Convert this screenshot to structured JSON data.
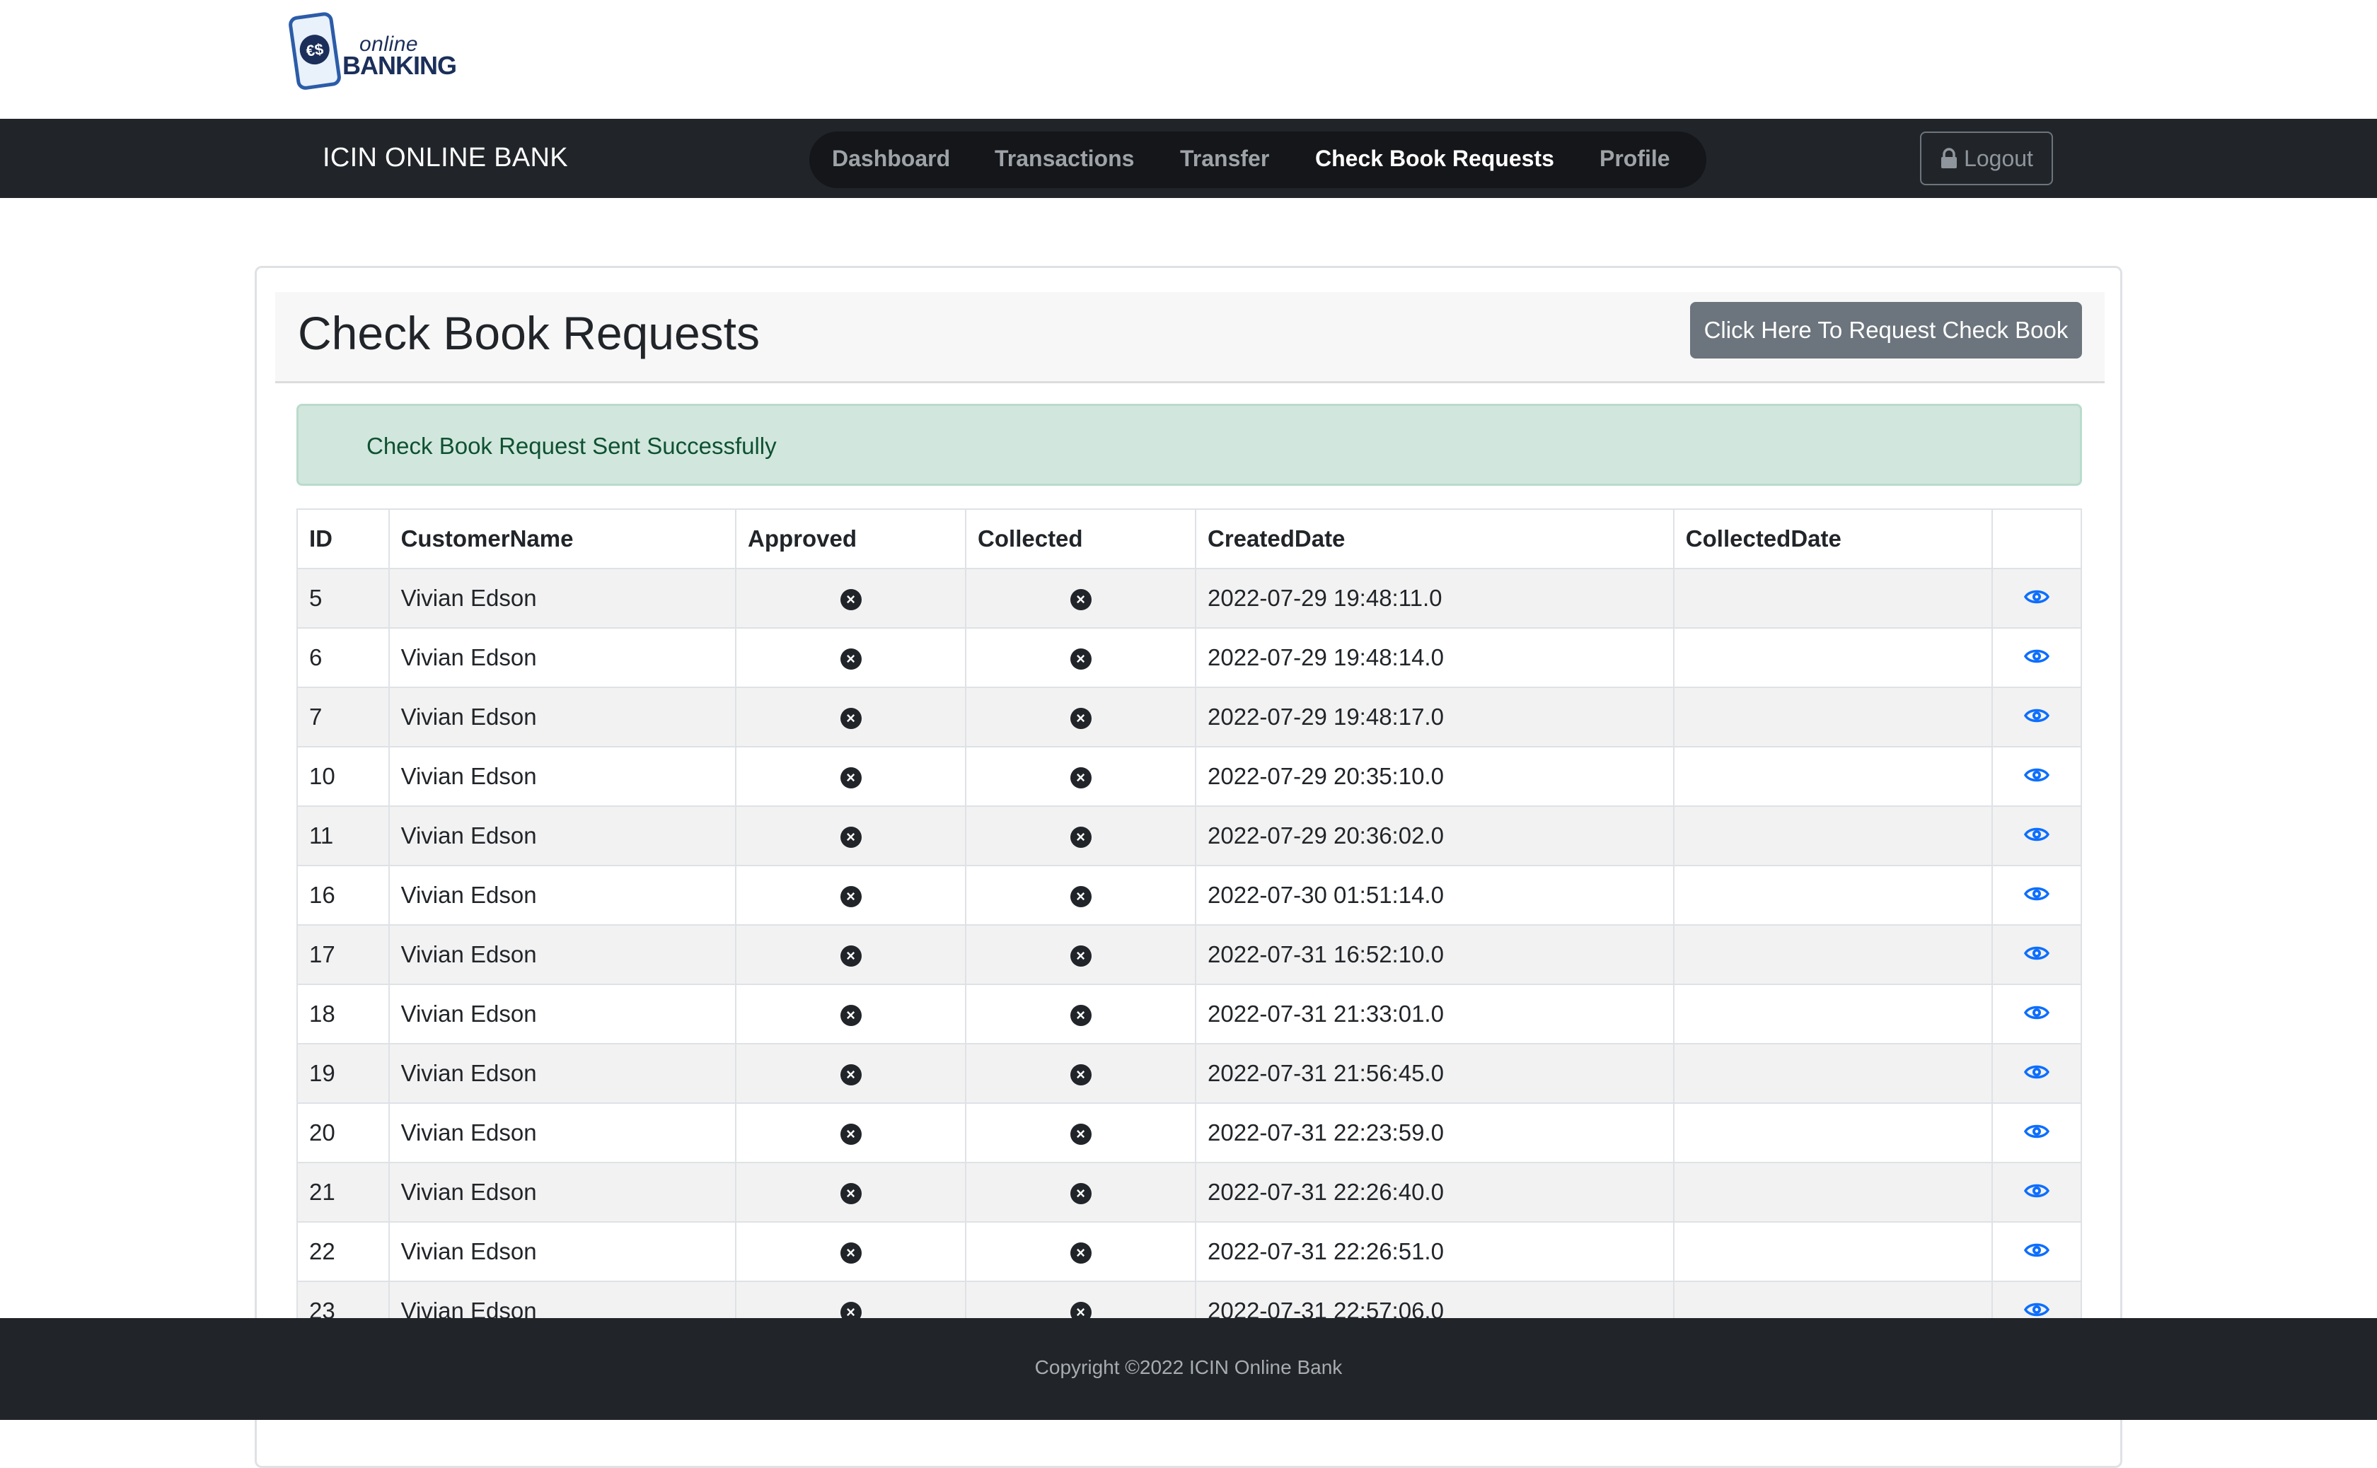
{
  "logo": {
    "small": "online",
    "big": "BANKING"
  },
  "navbar": {
    "brand": "ICIN ONLINE BANK",
    "links": [
      "Dashboard",
      "Transactions",
      "Transfer",
      "Check Book Requests",
      "Profile"
    ],
    "active": "Check Book Requests",
    "logout_label": "Logout"
  },
  "page": {
    "title": "Check Book Requests",
    "request_button": "Click Here To Request Check Book",
    "alert": "Check Book Request Sent Successfully"
  },
  "table": {
    "headers": [
      "ID",
      "CustomerName",
      "Approved",
      "Collected",
      "CreatedDate",
      "CollectedDate",
      ""
    ],
    "rows": [
      {
        "id": "5",
        "name": "Vivian Edson",
        "approved": false,
        "collected": false,
        "created": "2022-07-29 19:48:11.0",
        "collected_date": ""
      },
      {
        "id": "6",
        "name": "Vivian Edson",
        "approved": false,
        "collected": false,
        "created": "2022-07-29 19:48:14.0",
        "collected_date": ""
      },
      {
        "id": "7",
        "name": "Vivian Edson",
        "approved": false,
        "collected": false,
        "created": "2022-07-29 19:48:17.0",
        "collected_date": ""
      },
      {
        "id": "10",
        "name": "Vivian Edson",
        "approved": false,
        "collected": false,
        "created": "2022-07-29 20:35:10.0",
        "collected_date": ""
      },
      {
        "id": "11",
        "name": "Vivian Edson",
        "approved": false,
        "collected": false,
        "created": "2022-07-29 20:36:02.0",
        "collected_date": ""
      },
      {
        "id": "16",
        "name": "Vivian Edson",
        "approved": false,
        "collected": false,
        "created": "2022-07-30 01:51:14.0",
        "collected_date": ""
      },
      {
        "id": "17",
        "name": "Vivian Edson",
        "approved": false,
        "collected": false,
        "created": "2022-07-31 16:52:10.0",
        "collected_date": ""
      },
      {
        "id": "18",
        "name": "Vivian Edson",
        "approved": false,
        "collected": false,
        "created": "2022-07-31 21:33:01.0",
        "collected_date": ""
      },
      {
        "id": "19",
        "name": "Vivian Edson",
        "approved": false,
        "collected": false,
        "created": "2022-07-31 21:56:45.0",
        "collected_date": ""
      },
      {
        "id": "20",
        "name": "Vivian Edson",
        "approved": false,
        "collected": false,
        "created": "2022-07-31 22:23:59.0",
        "collected_date": ""
      },
      {
        "id": "21",
        "name": "Vivian Edson",
        "approved": false,
        "collected": false,
        "created": "2022-07-31 22:26:40.0",
        "collected_date": ""
      },
      {
        "id": "22",
        "name": "Vivian Edson",
        "approved": false,
        "collected": false,
        "created": "2022-07-31 22:26:51.0",
        "collected_date": ""
      },
      {
        "id": "23",
        "name": "Vivian Edson",
        "approved": false,
        "collected": false,
        "created": "2022-07-31 22:57:06.0",
        "collected_date": ""
      }
    ]
  },
  "icons": {
    "status_false": "x-circle-icon",
    "view": "eye-icon",
    "logout": "lock-icon"
  },
  "colors": {
    "navbar": "#212529",
    "accent_blue": "#0d6efd",
    "alert_bg": "#d1e7dd",
    "alert_text": "#0f5132",
    "button_gray": "#6c757d"
  },
  "footer": {
    "copyright": "Copyright ©2022 ICIN Online Bank"
  }
}
